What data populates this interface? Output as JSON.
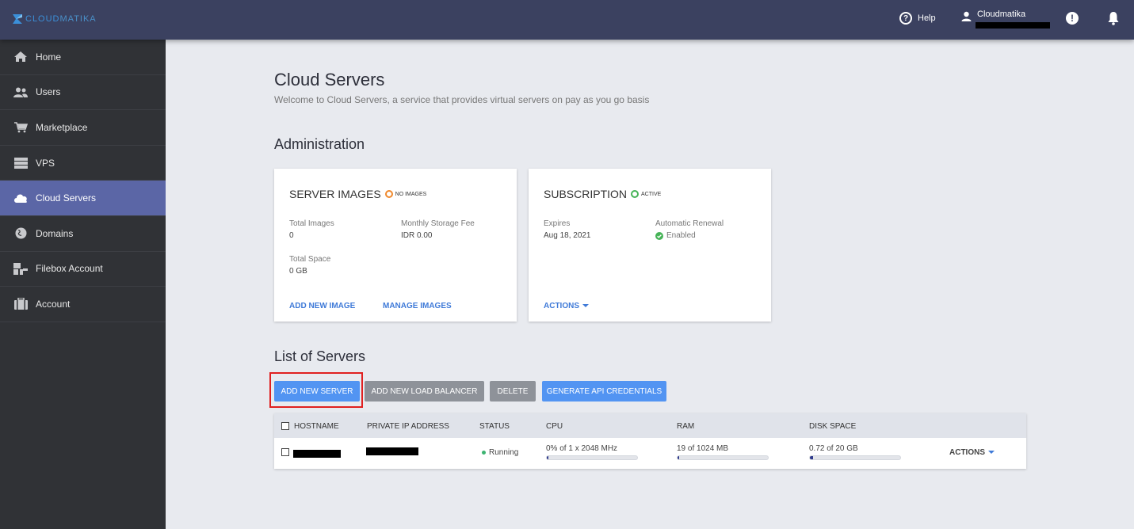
{
  "brand": {
    "logo_text_a": "CLOUD",
    "logo_text_b": "MATIKA"
  },
  "topbar": {
    "help_label": "Help",
    "user_name": "Cloudmatika",
    "alert_glyph": "!"
  },
  "sidebar": {
    "items": [
      {
        "label": "Home",
        "icon": "home-icon"
      },
      {
        "label": "Users",
        "icon": "users-icon"
      },
      {
        "label": "Marketplace",
        "icon": "cart-icon"
      },
      {
        "label": "VPS",
        "icon": "server-icon"
      },
      {
        "label": "Cloud Servers",
        "icon": "cloud-icon",
        "active": true
      },
      {
        "label": "Domains",
        "icon": "globe-icon"
      },
      {
        "label": "Filebox Account",
        "icon": "sitemap-icon"
      },
      {
        "label": "Account",
        "icon": "briefcase-icon"
      }
    ]
  },
  "page": {
    "title": "Cloud Servers",
    "subtitle": "Welcome to Cloud Servers, a service that provides virtual servers on pay as you go basis"
  },
  "administration": {
    "title": "Administration",
    "server_images": {
      "title": "SERVER IMAGES",
      "status": "NO IMAGES",
      "status_color": "#f0892d",
      "total_images_label": "Total Images",
      "total_images_value": "0",
      "storage_fee_label": "Monthly Storage Fee",
      "storage_fee_value": "IDR 0.00",
      "total_space_label": "Total Space",
      "total_space_value": "0 GB",
      "add_link": "ADD NEW IMAGE",
      "manage_link": "MANAGE IMAGES"
    },
    "subscription": {
      "title": "SUBSCRIPTION",
      "status": "ACTIVE",
      "status_color": "#46b357",
      "expires_label": "Expires",
      "expires_value": "Aug 18, 2021",
      "renewal_label": "Automatic Renewal",
      "renewal_value": "Enabled",
      "actions_link": "ACTIONS"
    }
  },
  "servers": {
    "title": "List of Servers",
    "buttons": {
      "add_server": "ADD NEW SERVER",
      "add_lb": "ADD NEW LOAD BALANCER",
      "delete": "DELETE",
      "api": "GENERATE API CREDENTIALS"
    },
    "columns": [
      "HOSTNAME",
      "PRIVATE IP ADDRESS",
      "STATUS",
      "CPU",
      "RAM",
      "DISK SPACE"
    ],
    "rows": [
      {
        "status": "Running",
        "cpu": "0% of 1 x 2048 MHz",
        "cpu_fraction": 0.0,
        "ram": "19 of 1024 MB",
        "ram_fraction": 0.019,
        "disk": "0.72 of 20 GB",
        "disk_fraction": 0.036,
        "actions": "ACTIONS"
      }
    ]
  }
}
